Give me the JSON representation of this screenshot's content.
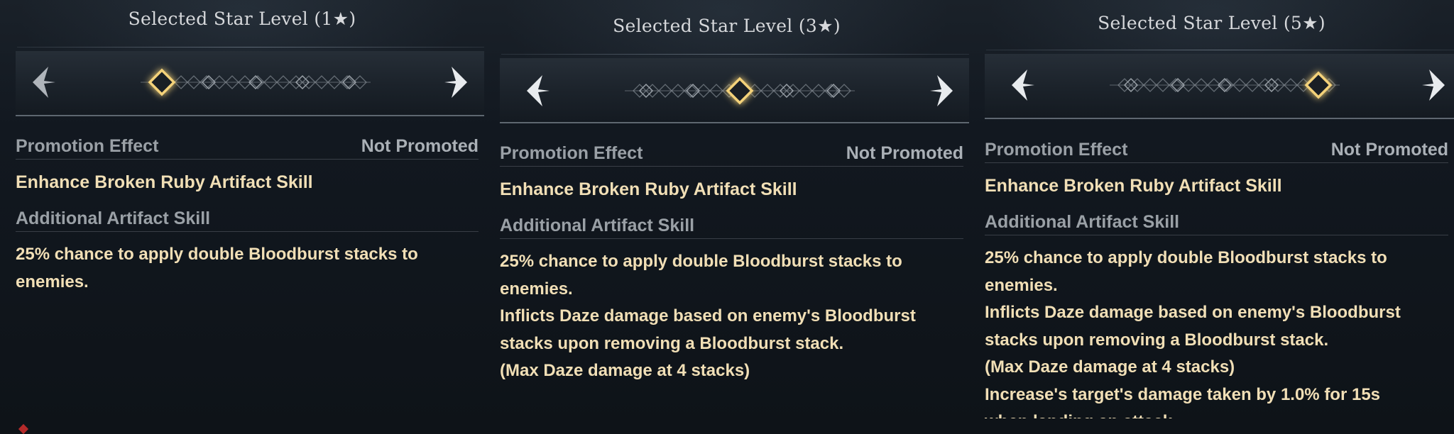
{
  "panels": [
    {
      "title": "Selected Star Level (1★)",
      "selected_star": 1,
      "promotion_label": "Promotion Effect",
      "promotion_status": "Not Promoted",
      "skill_name": "Enhance Broken Ruby Artifact Skill",
      "additional_label": "Additional Artifact Skill",
      "description_lines": [
        "25% chance to apply double Bloodburst stacks to",
        "enemies."
      ]
    },
    {
      "title": "Selected Star Level (3★)",
      "selected_star": 3,
      "promotion_label": "Promotion Effect",
      "promotion_status": "Not Promoted",
      "skill_name": "Enhance Broken Ruby Artifact Skill",
      "additional_label": "Additional Artifact Skill",
      "description_lines": [
        "25% chance to apply double Bloodburst stacks to",
        "enemies.",
        "Inflicts Daze damage based on enemy's Bloodburst",
        "stacks upon removing a Bloodburst stack.",
        "(Max Daze damage at 4 stacks)"
      ]
    },
    {
      "title": "Selected Star Level (5★)",
      "selected_star": 5,
      "promotion_label": "Promotion Effect",
      "promotion_status": "Not Promoted",
      "skill_name": "Enhance Broken Ruby Artifact Skill",
      "additional_label": "Additional Artifact Skill",
      "description_lines": [
        "25% chance to apply double Bloodburst stacks to",
        "enemies.",
        "Inflicts Daze damage based on enemy's Bloodburst",
        "stacks upon removing a Bloodburst stack.",
        "(Max Daze damage at 4 stacks)",
        "Increase's target's damage taken by 1.0% for 15s",
        "when landing an attack."
      ]
    }
  ],
  "icons": {
    "prev": "chevron-left-icon",
    "next": "chevron-right-icon",
    "star_slot": "diamond-star-icon"
  },
  "colors": {
    "title": "#d6d8db",
    "label": "#9aa0a6",
    "highlight_text": "#f1dfb6",
    "selected_glow": "#f4d27a"
  }
}
